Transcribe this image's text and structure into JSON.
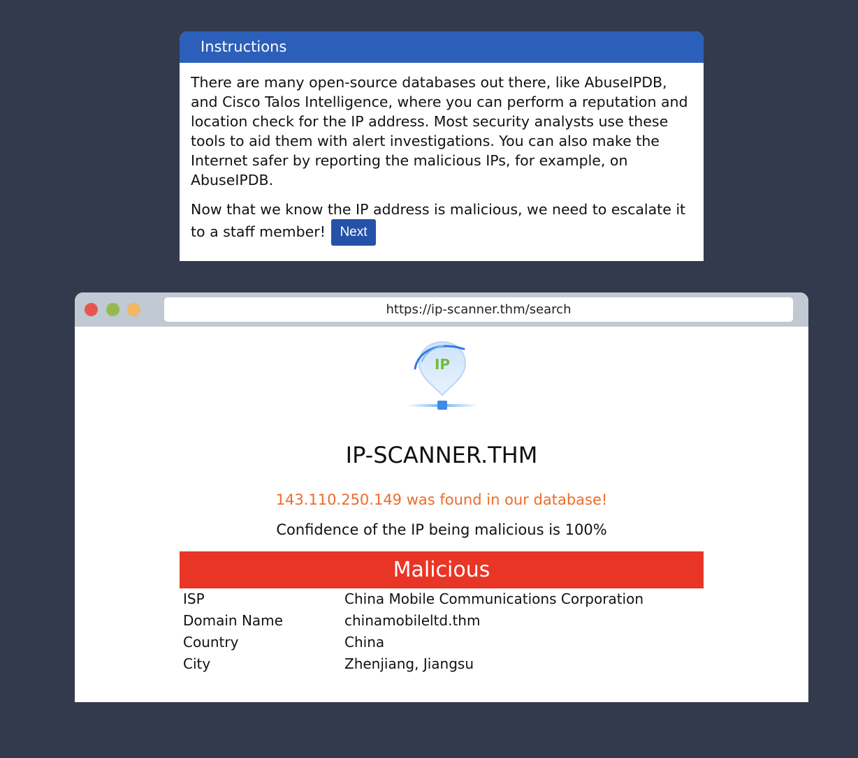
{
  "instructions": {
    "title": "Instructions",
    "paragraph1": "There are many open-source databases out there, like AbuseIPDB, and Cisco Talos Intelligence, where you can perform a reputation and location check for the IP address. Most security analysts use these tools to aid them with alert investigations. You can also make the Internet safer by reporting the malicious IPs, for example, on AbuseIPDB.",
    "paragraph2": "Now that we know the IP address is malicious, we need to escalate it to a staff member!",
    "next_label": "Next"
  },
  "browser": {
    "url": "https://ip-scanner.thm/search"
  },
  "site": {
    "logo_text": "IP",
    "title": "IP-SCANNER.THM",
    "found_message": "143.110.250.149 was found in our database!",
    "confidence_message": "Confidence of the IP being malicious is 100%",
    "verdict": "Malicious",
    "details": [
      {
        "key": "ISP",
        "value": "China Mobile Communications Corporation"
      },
      {
        "key": "Domain Name",
        "value": "chinamobileltd.thm"
      },
      {
        "key": "Country",
        "value": "China"
      },
      {
        "key": "City",
        "value": "Zhenjiang, Jiangsu"
      }
    ]
  },
  "colors": {
    "background": "#333a4d",
    "header_blue": "#2c5fb9",
    "button_blue": "#2552a8",
    "found_orange": "#ee6b2a",
    "verdict_red": "#e93526"
  }
}
